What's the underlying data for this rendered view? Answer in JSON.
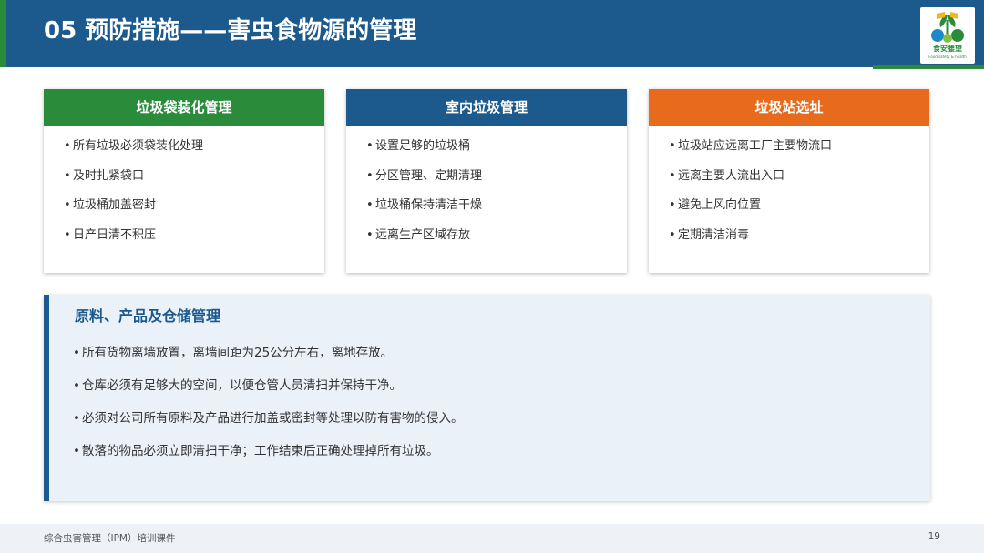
{
  "header": {
    "title": "05  预防措施——害虫食物源的管理",
    "background_color": "#1c5a8e",
    "accent_color": "#2a8b3b"
  },
  "logo": {
    "text": "食安腰望",
    "subtext": "Food safety & health",
    "icon": "plant-logo-icon"
  },
  "cards": [
    {
      "title": "垃圾袋装化管理",
      "color": "#2a8b3b",
      "items": [
        "所有垃圾必须袋装化处理",
        "及时扎紧袋口",
        "垃圾桶加盖密封",
        "日产日清不积压"
      ]
    },
    {
      "title": "室内垃圾管理",
      "color": "#1c5a8e",
      "items": [
        "设置足够的垃圾桶",
        "分区管理、定期清理",
        "垃圾桶保持清洁干燥",
        "远离生产区域存放"
      ]
    },
    {
      "title": "垃圾站选址",
      "color": "#e86a1c",
      "items": [
        "垃圾站应远离工厂主要物流口",
        "远离主要人流出入口",
        "避免上风向位置",
        "定期清洁消毒"
      ]
    }
  ],
  "panel": {
    "title": "原料、产品及仓储管理",
    "items": [
      "所有货物离墙放置，离墙间距为25公分左右，离地存放。",
      "仓库必须有足够大的空间，以便仓管人员清扫并保持干净。",
      "必须对公司所有原料及产品进行加盖或密封等处理以防有害物的侵入。",
      "散落的物品必须立即清扫干净；工作结束后正确处理掉所有垃圾。"
    ]
  },
  "bullet": "•",
  "footer": {
    "text": "综合虫害管理（IPM）培训课件",
    "page_number": "19"
  }
}
